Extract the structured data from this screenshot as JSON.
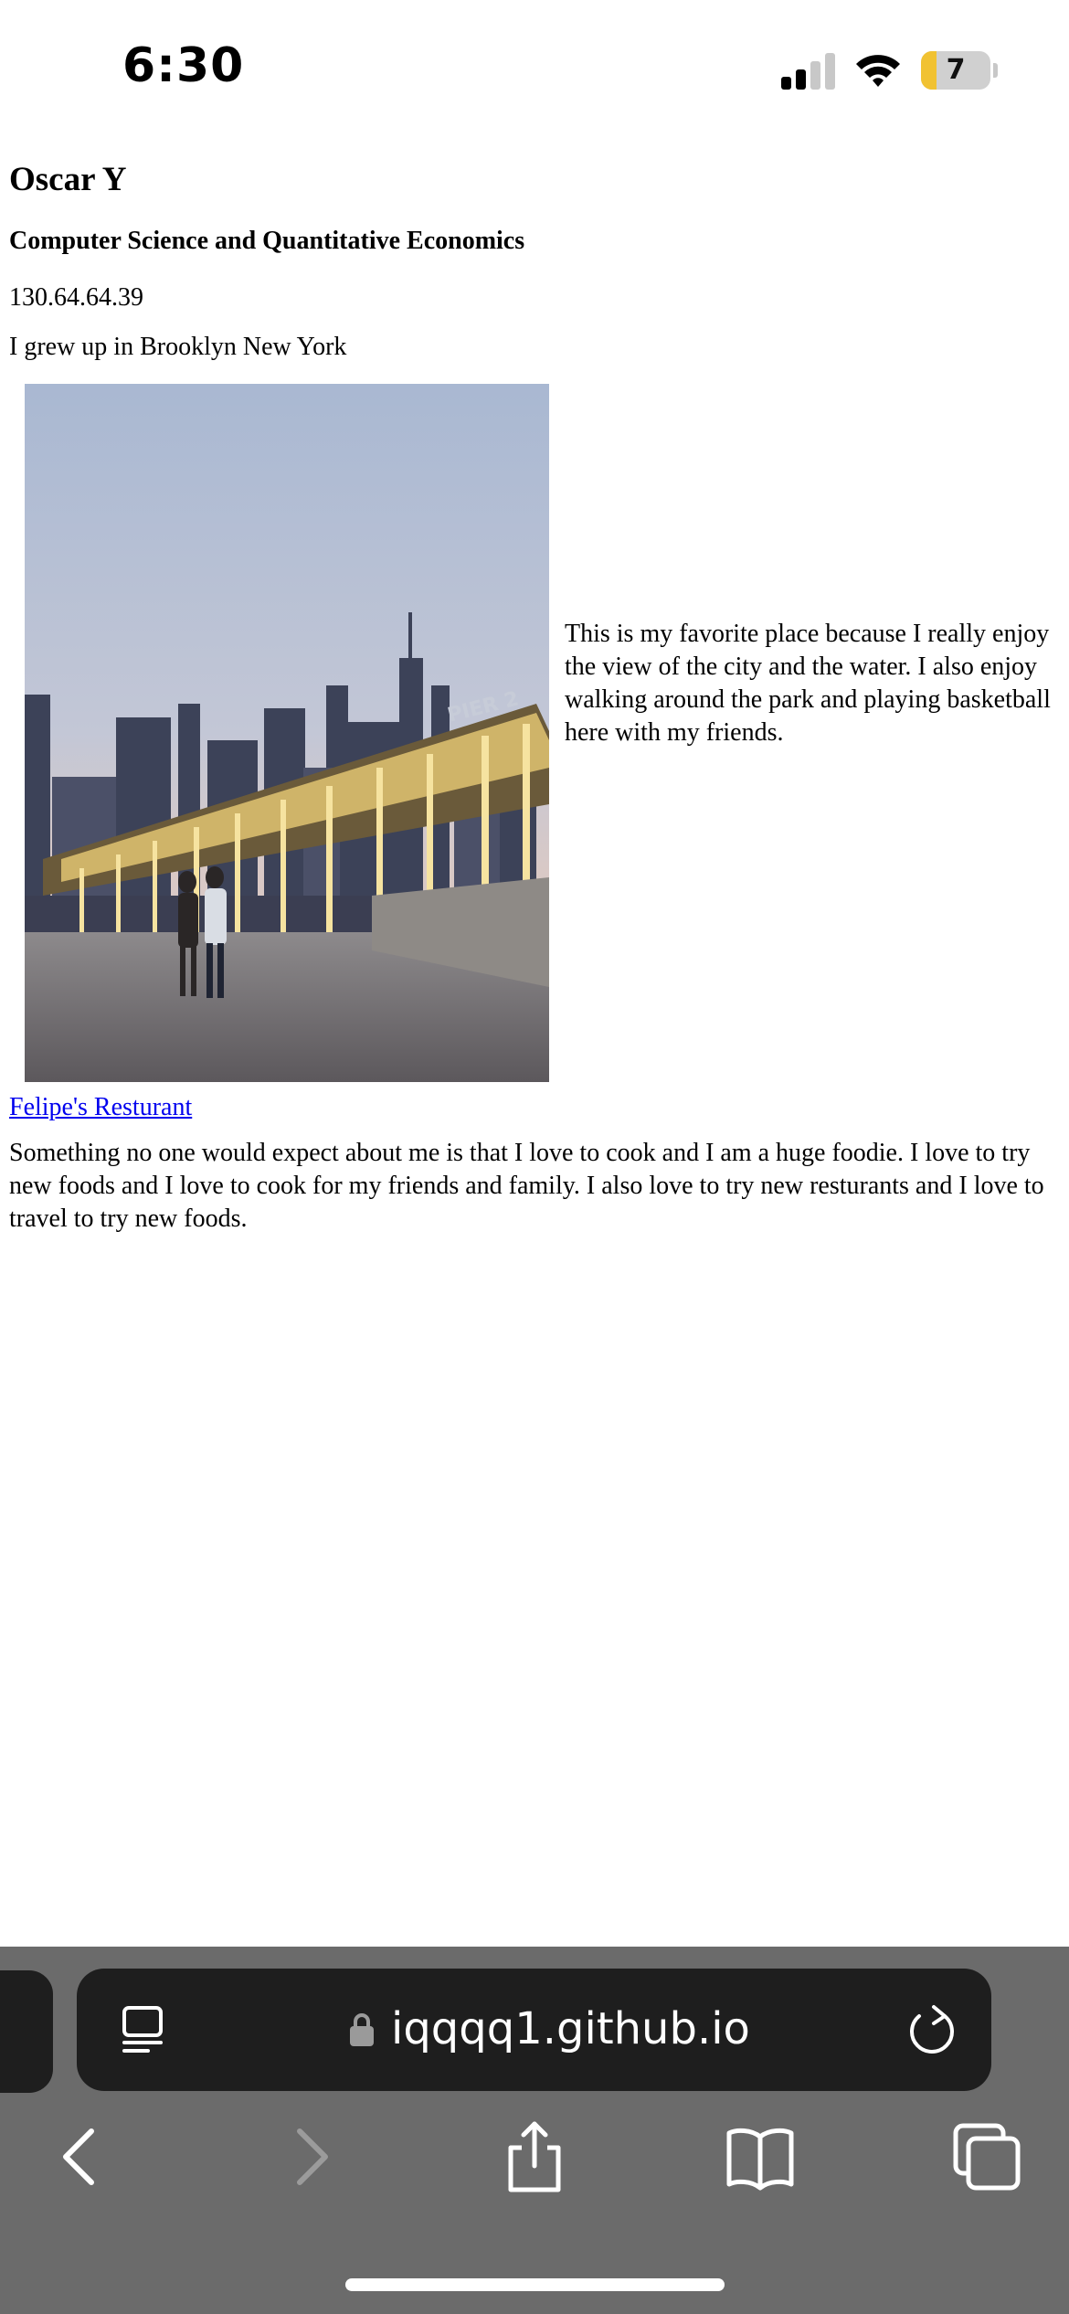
{
  "status_bar": {
    "time": "6:30",
    "battery_level": "7",
    "battery_fraction": 0.07,
    "battery_color": "#f1c232"
  },
  "page": {
    "name": "Oscar Y",
    "major": "Computer Science and Quantitative Economics",
    "ip_address": "130.64.64.39",
    "hometown": "I grew up in Brooklyn New York",
    "favorite_place_text": "This is my favorite place because I really enjoy the view of the city and the water. I also enjoy walking around the park and playing basketball here with my friends.",
    "link_text": "Felipe's Resturant",
    "link_color": "#0000ee",
    "fun_fact": "Something no one would expect about me is that I love to cook and I am a huge foodie. I love to try new foods and I love to cook for my friends and family. I also love to try new resturants and I love to travel to try new foods.",
    "photo_sign_text": "PIER 2"
  },
  "browser": {
    "url": "iqqqq1.github.io",
    "icons": {
      "reader": "reader-mode-icon",
      "lock": "lock-icon",
      "reload": "reload-icon",
      "back": "back-chevron-icon",
      "forward": "forward-chevron-icon",
      "share": "share-icon",
      "bookmarks": "bookmarks-book-icon",
      "tabs": "tabs-icon"
    }
  }
}
